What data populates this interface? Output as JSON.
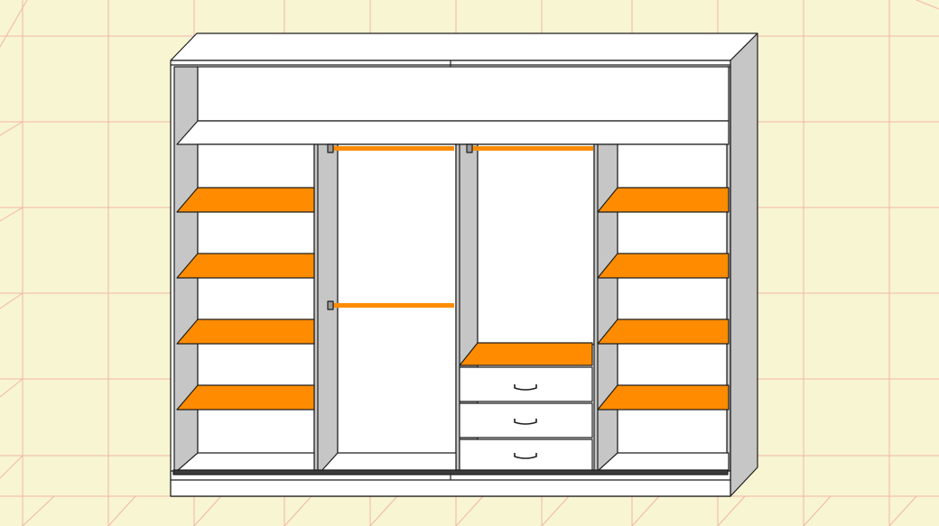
{
  "colors": {
    "background": "#f8f5d3",
    "grid": "#f1b6a5",
    "shelf": "#ff8c00",
    "rail": "#ff8c00",
    "panel_front": "#ffffff",
    "panel_side": "#c6c6c6",
    "outline": "#1e1e1e"
  },
  "wardrobe": {
    "sections": [
      {
        "name": "left-shelving",
        "shelves": 4
      },
      {
        "name": "center-left-hanging",
        "rails": 2
      },
      {
        "name": "center-right-hanging",
        "rails": 1,
        "shelves": 1,
        "drawers": 3
      },
      {
        "name": "right-shelving",
        "shelves": 4
      }
    ],
    "top_compartment": true,
    "sliding_door_track": true
  }
}
